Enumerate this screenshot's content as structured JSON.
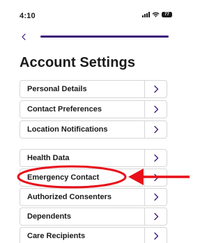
{
  "status_bar": {
    "time": "4:10",
    "battery_level": "77",
    "icons": [
      "signal-icon",
      "wifi-icon",
      "battery-icon"
    ]
  },
  "nav": {
    "back_icon": "chevron-left-icon",
    "progress_fraction": 1.0
  },
  "page_title": "Account Settings",
  "settings_items": [
    {
      "label": "Personal Details"
    },
    {
      "label": "Contact Preferences"
    },
    {
      "label": "Location Notifications"
    },
    {
      "label": "Health Data"
    },
    {
      "label": "Emergency Contact"
    },
    {
      "label": "Authorized Consenters"
    },
    {
      "label": "Dependents"
    },
    {
      "label": "Care Recipients"
    }
  ],
  "annotation": {
    "highlighted_item": "Emergency Contact",
    "color": "#e8101a"
  },
  "colors": {
    "accent": "#3a1478",
    "border": "#d6d6d6",
    "chevron": "#3a1478",
    "text": "#1a1a1a"
  }
}
